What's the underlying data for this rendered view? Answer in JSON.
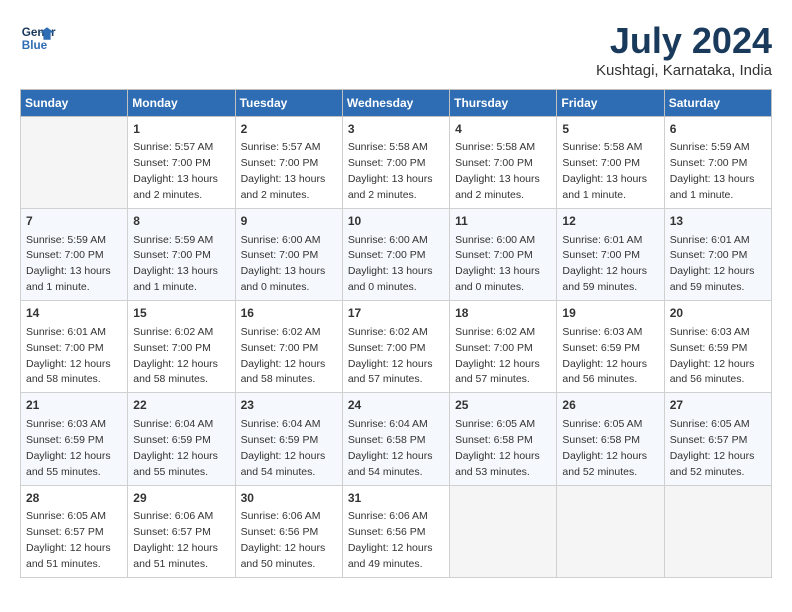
{
  "logo": {
    "line1": "General",
    "line2": "Blue"
  },
  "title": "July 2024",
  "subtitle": "Kushtagi, Karnataka, India",
  "days_of_week": [
    "Sunday",
    "Monday",
    "Tuesday",
    "Wednesday",
    "Thursday",
    "Friday",
    "Saturday"
  ],
  "weeks": [
    [
      {
        "day": "",
        "info": ""
      },
      {
        "day": "1",
        "info": "Sunrise: 5:57 AM\nSunset: 7:00 PM\nDaylight: 13 hours\nand 2 minutes."
      },
      {
        "day": "2",
        "info": "Sunrise: 5:57 AM\nSunset: 7:00 PM\nDaylight: 13 hours\nand 2 minutes."
      },
      {
        "day": "3",
        "info": "Sunrise: 5:58 AM\nSunset: 7:00 PM\nDaylight: 13 hours\nand 2 minutes."
      },
      {
        "day": "4",
        "info": "Sunrise: 5:58 AM\nSunset: 7:00 PM\nDaylight: 13 hours\nand 2 minutes."
      },
      {
        "day": "5",
        "info": "Sunrise: 5:58 AM\nSunset: 7:00 PM\nDaylight: 13 hours\nand 1 minute."
      },
      {
        "day": "6",
        "info": "Sunrise: 5:59 AM\nSunset: 7:00 PM\nDaylight: 13 hours\nand 1 minute."
      }
    ],
    [
      {
        "day": "7",
        "info": "Sunrise: 5:59 AM\nSunset: 7:00 PM\nDaylight: 13 hours\nand 1 minute."
      },
      {
        "day": "8",
        "info": "Sunrise: 5:59 AM\nSunset: 7:00 PM\nDaylight: 13 hours\nand 1 minute."
      },
      {
        "day": "9",
        "info": "Sunrise: 6:00 AM\nSunset: 7:00 PM\nDaylight: 13 hours\nand 0 minutes."
      },
      {
        "day": "10",
        "info": "Sunrise: 6:00 AM\nSunset: 7:00 PM\nDaylight: 13 hours\nand 0 minutes."
      },
      {
        "day": "11",
        "info": "Sunrise: 6:00 AM\nSunset: 7:00 PM\nDaylight: 13 hours\nand 0 minutes."
      },
      {
        "day": "12",
        "info": "Sunrise: 6:01 AM\nSunset: 7:00 PM\nDaylight: 12 hours\nand 59 minutes."
      },
      {
        "day": "13",
        "info": "Sunrise: 6:01 AM\nSunset: 7:00 PM\nDaylight: 12 hours\nand 59 minutes."
      }
    ],
    [
      {
        "day": "14",
        "info": "Sunrise: 6:01 AM\nSunset: 7:00 PM\nDaylight: 12 hours\nand 58 minutes."
      },
      {
        "day": "15",
        "info": "Sunrise: 6:02 AM\nSunset: 7:00 PM\nDaylight: 12 hours\nand 58 minutes."
      },
      {
        "day": "16",
        "info": "Sunrise: 6:02 AM\nSunset: 7:00 PM\nDaylight: 12 hours\nand 58 minutes."
      },
      {
        "day": "17",
        "info": "Sunrise: 6:02 AM\nSunset: 7:00 PM\nDaylight: 12 hours\nand 57 minutes."
      },
      {
        "day": "18",
        "info": "Sunrise: 6:02 AM\nSunset: 7:00 PM\nDaylight: 12 hours\nand 57 minutes."
      },
      {
        "day": "19",
        "info": "Sunrise: 6:03 AM\nSunset: 6:59 PM\nDaylight: 12 hours\nand 56 minutes."
      },
      {
        "day": "20",
        "info": "Sunrise: 6:03 AM\nSunset: 6:59 PM\nDaylight: 12 hours\nand 56 minutes."
      }
    ],
    [
      {
        "day": "21",
        "info": "Sunrise: 6:03 AM\nSunset: 6:59 PM\nDaylight: 12 hours\nand 55 minutes."
      },
      {
        "day": "22",
        "info": "Sunrise: 6:04 AM\nSunset: 6:59 PM\nDaylight: 12 hours\nand 55 minutes."
      },
      {
        "day": "23",
        "info": "Sunrise: 6:04 AM\nSunset: 6:59 PM\nDaylight: 12 hours\nand 54 minutes."
      },
      {
        "day": "24",
        "info": "Sunrise: 6:04 AM\nSunset: 6:58 PM\nDaylight: 12 hours\nand 54 minutes."
      },
      {
        "day": "25",
        "info": "Sunrise: 6:05 AM\nSunset: 6:58 PM\nDaylight: 12 hours\nand 53 minutes."
      },
      {
        "day": "26",
        "info": "Sunrise: 6:05 AM\nSunset: 6:58 PM\nDaylight: 12 hours\nand 52 minutes."
      },
      {
        "day": "27",
        "info": "Sunrise: 6:05 AM\nSunset: 6:57 PM\nDaylight: 12 hours\nand 52 minutes."
      }
    ],
    [
      {
        "day": "28",
        "info": "Sunrise: 6:05 AM\nSunset: 6:57 PM\nDaylight: 12 hours\nand 51 minutes."
      },
      {
        "day": "29",
        "info": "Sunrise: 6:06 AM\nSunset: 6:57 PM\nDaylight: 12 hours\nand 51 minutes."
      },
      {
        "day": "30",
        "info": "Sunrise: 6:06 AM\nSunset: 6:56 PM\nDaylight: 12 hours\nand 50 minutes."
      },
      {
        "day": "31",
        "info": "Sunrise: 6:06 AM\nSunset: 6:56 PM\nDaylight: 12 hours\nand 49 minutes."
      },
      {
        "day": "",
        "info": ""
      },
      {
        "day": "",
        "info": ""
      },
      {
        "day": "",
        "info": ""
      }
    ]
  ]
}
